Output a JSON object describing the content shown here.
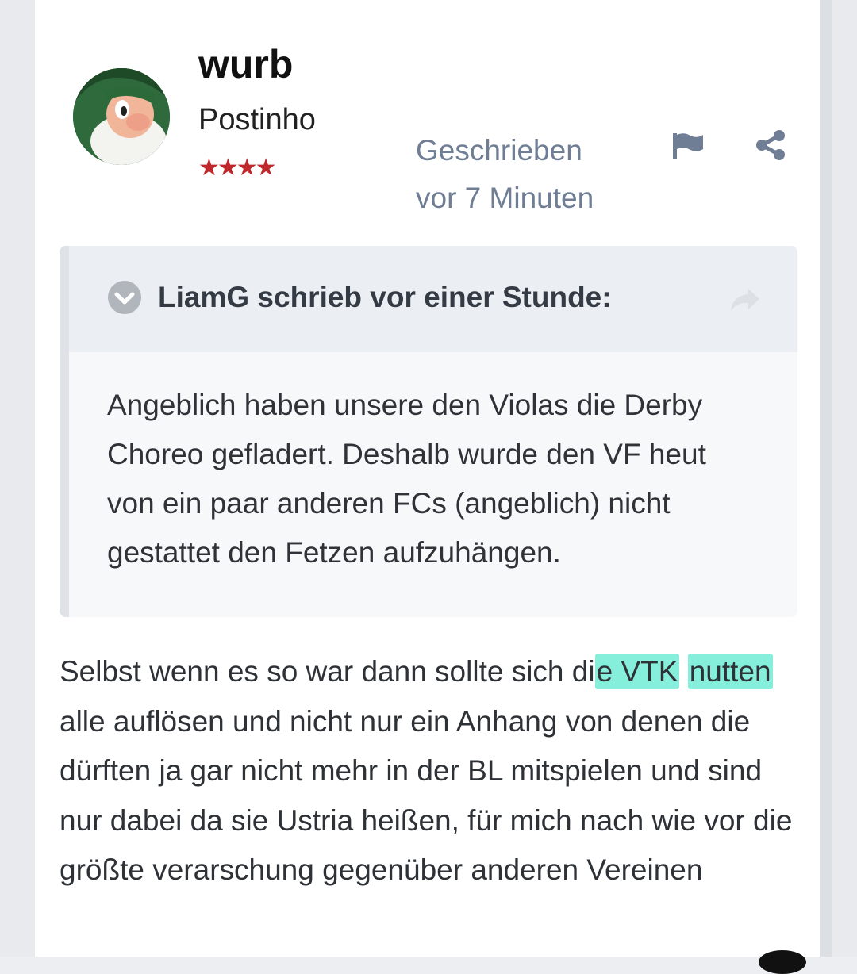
{
  "post": {
    "username": "wurb",
    "rank_title": "Postinho",
    "rank_stars": "★★★★",
    "written_line1": "Geschrieben",
    "written_line2": "vor 7 Minuten"
  },
  "icons": {
    "report": "flag-icon",
    "share": "share-icon",
    "quote_toggle": "chevron-down-icon",
    "quote_goto": "arrow-right-icon"
  },
  "quote": {
    "author_line": "LiamG schrieb vor einer Stunde:",
    "text": "Angeblich haben unsere den Violas die Derby Choreo gefladert. Deshalb wurde den VF heut von ein paar anderen FCs (angeblich) nicht gestattet den Fetzen aufzuhängen."
  },
  "body": {
    "part1": "Selbst wenn es so war dann sollte sich di",
    "highlight1": "e VTK",
    "space": " ",
    "highlight2": "nutten",
    "part2": " alle auflösen und nicht nur ein Anhang von denen die dürften ja gar nicht mehr in der BL mitspielen und sind nur dabei da sie Ustria heißen, für mich nach wie vor die größte verarschung gegenüber anderen Vereinen"
  },
  "colors": {
    "meta_text": "#6f7e95",
    "stars": "#c0272d",
    "highlight": "#20e2be"
  }
}
